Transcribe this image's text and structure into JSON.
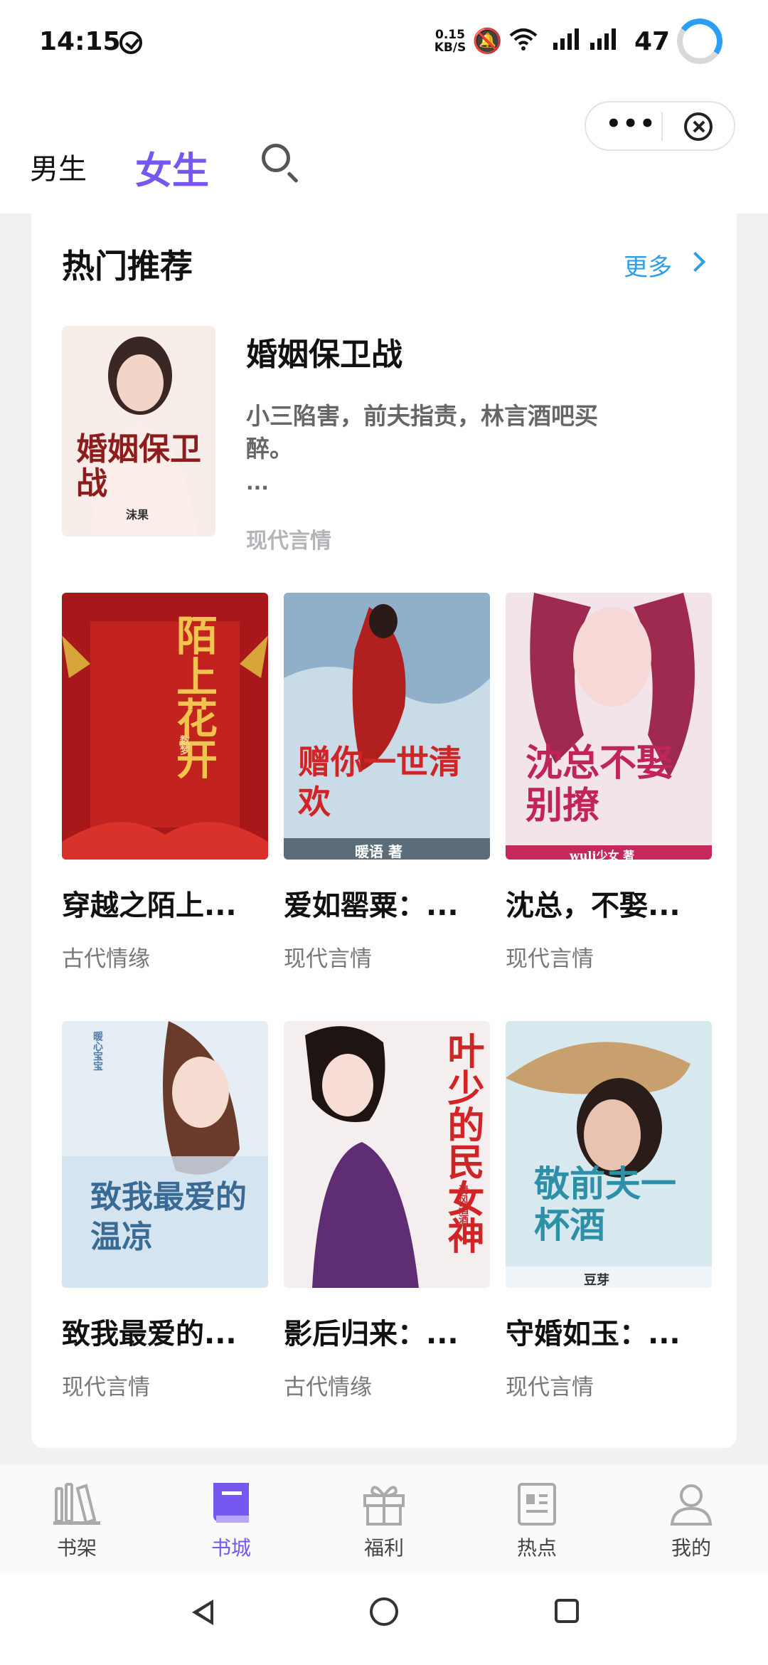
{
  "status": {
    "time": "14:15",
    "speed_top": "0.15",
    "speed_bottom": "KB/S",
    "battery": "47"
  },
  "header": {
    "tab_male": "男生",
    "tab_female": "女生",
    "more_menu": "•••"
  },
  "section": {
    "title": "热门推荐",
    "more": "更多"
  },
  "featured": {
    "title": "婚姻保卫战",
    "description": "小三陷害，前夫指责，林言酒吧买醉。",
    "ellipsis": "...",
    "genre": "现代言情",
    "cover_text": "婚姻保卫战",
    "cover_author": "沫果"
  },
  "books": [
    {
      "title": "穿越之陌上...",
      "genre": "古代情缘",
      "cover_text": "陌上花开",
      "cover_author": "数梦"
    },
    {
      "title": "爱如罂粟：...",
      "genre": "现代言情",
      "cover_text": "赠你一世清欢",
      "cover_author": "暖语 著"
    },
    {
      "title": "沈总，不娶...",
      "genre": "现代言情",
      "cover_text": "沈总不娶别撩",
      "cover_author": "wuli少女 著"
    },
    {
      "title": "致我最爱的...",
      "genre": "现代言情",
      "cover_text": "致我最爱的温凉",
      "cover_author": "暖心宝宝"
    },
    {
      "title": "影后归来：...",
      "genre": "古代情缘",
      "cover_text": "叶少的民女神",
      "cover_author": "清风酒酒"
    },
    {
      "title": "守婚如玉：...",
      "genre": "现代言情",
      "cover_text": "敬前夫一杯酒",
      "cover_author": "豆芽"
    }
  ],
  "nav": [
    {
      "label": "书架"
    },
    {
      "label": "书城"
    },
    {
      "label": "福利"
    },
    {
      "label": "热点"
    },
    {
      "label": "我的"
    }
  ],
  "colors": {
    "accent": "#7657f2",
    "link": "#2d9ee8"
  }
}
